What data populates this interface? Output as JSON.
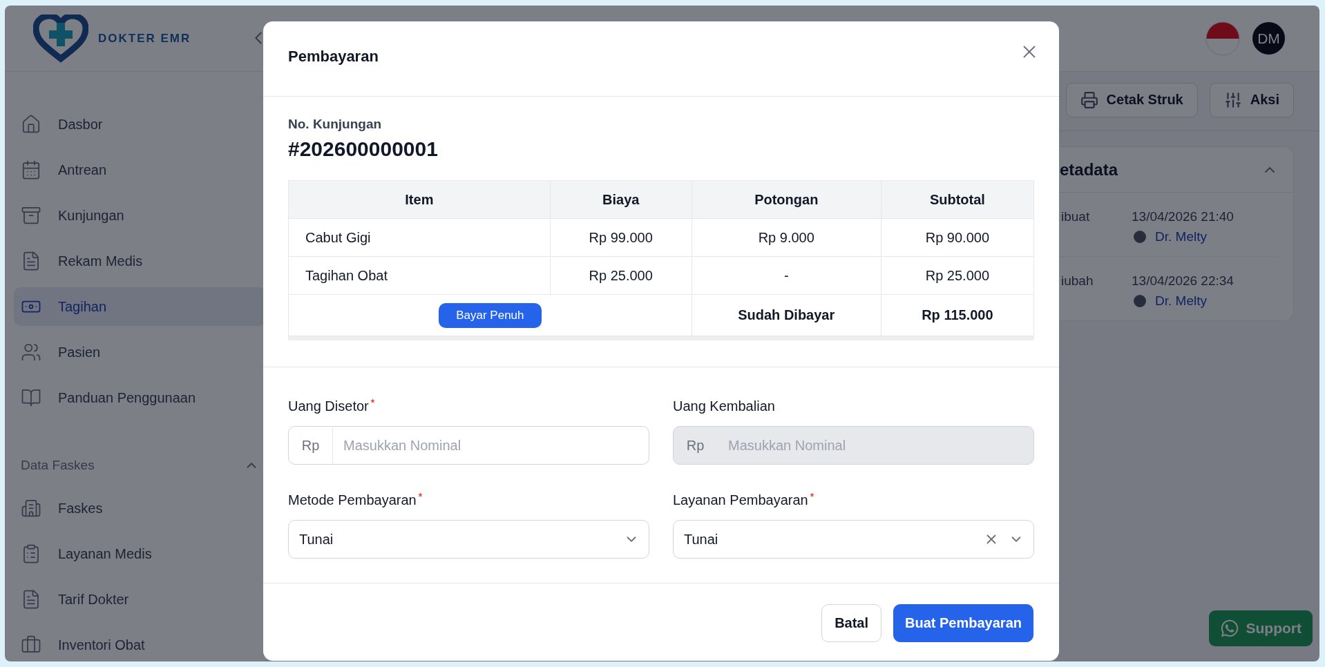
{
  "header": {
    "logo_text": "DOKTER EMR",
    "avatar_initials": "DM"
  },
  "sidebar": {
    "items": [
      {
        "label": "Dasbor",
        "kind": "home",
        "selected": false
      },
      {
        "label": "Antrean",
        "kind": "calendar",
        "selected": false
      },
      {
        "label": "Kunjungan",
        "kind": "tray",
        "selected": false
      },
      {
        "label": "Rekam Medis",
        "kind": "document",
        "selected": false
      },
      {
        "label": "Tagihan",
        "kind": "money",
        "selected": true
      },
      {
        "label": "Pasien",
        "kind": "people",
        "selected": false
      },
      {
        "label": "Panduan Penggunaan",
        "kind": "book",
        "selected": false
      }
    ],
    "sections": [
      {
        "title": "Data Faskes",
        "expanded": true,
        "items": [
          {
            "label": "Faskes",
            "kind": "building",
            "selected": false
          },
          {
            "label": "Layanan Medis",
            "kind": "clipboard",
            "selected": false
          },
          {
            "label": "Tarif Dokter",
            "kind": "document",
            "selected": false
          },
          {
            "label": "Inventori Obat",
            "kind": "briefcase",
            "selected": false
          }
        ]
      }
    ]
  },
  "toolbar": {
    "buttons": [
      {
        "label": "Cetak Struk",
        "kind": "print"
      },
      {
        "label": "Aksi",
        "kind": "sliders"
      }
    ]
  },
  "metadata_card": {
    "title": "etadata",
    "expanded": true,
    "rows": [
      {
        "label": "ibuat",
        "time": "13/04/2026 21:40",
        "user": "Dr. Melty"
      },
      {
        "label": "iubah",
        "time": "13/04/2026 22:34",
        "user": "Dr. Melty"
      }
    ]
  },
  "support_button": {
    "label": "Support"
  },
  "modal": {
    "title": "Pembayaran",
    "visit_label": "No. Kunjungan",
    "visit_number": "#202600000001",
    "table": {
      "columns": [
        "Item",
        "Biaya",
        "Potongan",
        "Subtotal"
      ],
      "rows": [
        {
          "cells": [
            "Cabut Gigi",
            "Rp 99.000",
            "Rp 9.000",
            "Rp 90.000"
          ]
        },
        {
          "cells": [
            "Tagihan Obat",
            "Rp 25.000",
            "-",
            "Rp 25.000"
          ]
        }
      ],
      "footer": {
        "button": "Bayar Penuh",
        "label": "Sudah Dibayar",
        "total": "Rp 115.000"
      }
    },
    "fields": [
      {
        "label": "Uang Disetor",
        "required": true,
        "kind": "amount",
        "prefix": "Rp",
        "placeholder": "Masukkan Nominal",
        "disabled": false
      },
      {
        "label": "Uang Kembalian",
        "required": false,
        "kind": "amount",
        "prefix": "Rp",
        "placeholder": "Masukkan Nominal",
        "disabled": true
      },
      {
        "label": "Metode Pembayaran",
        "required": true,
        "kind": "select",
        "value": "Tunai",
        "clearable": false
      },
      {
        "label": "Layanan Pembayaran",
        "required": true,
        "kind": "select",
        "value": "Tunai",
        "clearable": true
      }
    ],
    "buttons": [
      {
        "label": "Batal",
        "kind": "secondary"
      },
      {
        "label": "Buat Pembayaran",
        "kind": "primary"
      }
    ]
  }
}
